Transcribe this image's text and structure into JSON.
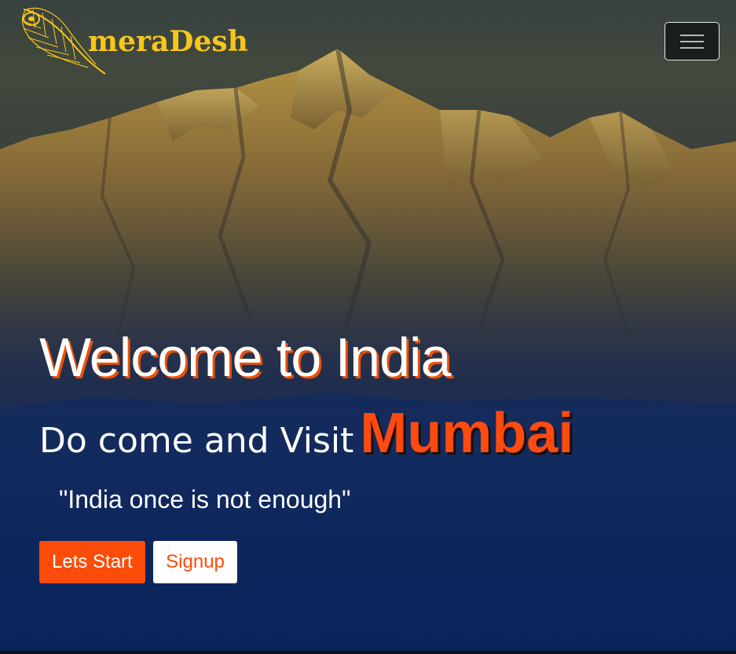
{
  "navbar": {
    "brand_name": "meraDesh",
    "logo_icon": "peacock-feather-icon",
    "menu_icon": "hamburger-menu-icon"
  },
  "hero": {
    "title": "Welcome to India",
    "subtitle_prefix": "Do come and Visit",
    "city": "Mumbai",
    "quote": "\"India once is not enough\""
  },
  "buttons": {
    "start_label": "Lets Start",
    "signup_label": "Signup"
  },
  "colors": {
    "accent": "#fb4c0a",
    "brand": "#f7c61b",
    "background": "#0b2150"
  }
}
